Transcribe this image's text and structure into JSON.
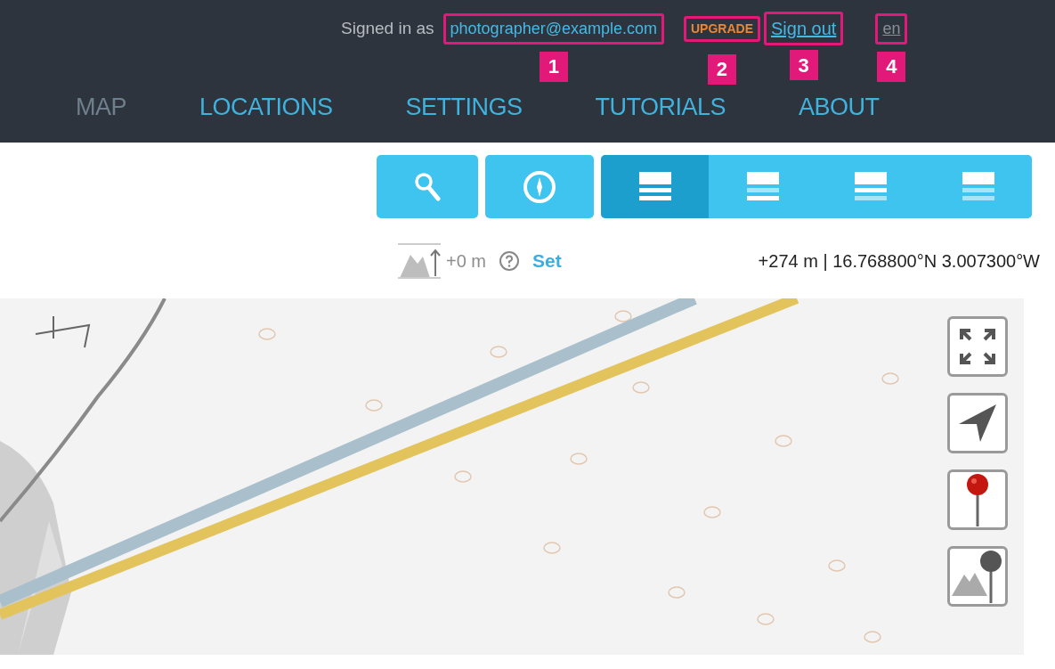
{
  "header": {
    "signed_in_label": "Signed in as",
    "links": [
      {
        "kind": "account",
        "text": "photographer@example.com",
        "callout": "1"
      },
      {
        "kind": "upgrade",
        "text": "UPGRADE",
        "callout": "2"
      },
      {
        "kind": "sign_out",
        "text": "Sign out",
        "callout": "3"
      },
      {
        "kind": "language",
        "text": "en",
        "callout": "4"
      }
    ]
  },
  "nav": [
    {
      "label": "MAP",
      "selected": true
    },
    {
      "label": "LOCATIONS",
      "selected": false
    },
    {
      "label": "SETTINGS",
      "selected": false
    },
    {
      "label": "TUTORIALS",
      "selected": false
    },
    {
      "label": "ABOUT",
      "selected": false
    }
  ],
  "toolbar": {
    "buttons": [
      {
        "kind": "search"
      },
      {
        "kind": "compass"
      }
    ],
    "layers": [
      {
        "kind": "all",
        "selected": true
      },
      {
        "kind": "base",
        "selected": false
      },
      {
        "kind": "mid",
        "selected": false
      },
      {
        "kind": "top",
        "selected": false
      }
    ]
  },
  "elevation": {
    "offset": "+0 m",
    "set_link": "Set"
  },
  "position": "+274 m | 16.768800°N 3.007300°W",
  "map": {
    "kind": "picture",
    "controls": [
      {
        "kind": "fullscreen"
      },
      {
        "kind": "locate"
      },
      {
        "kind": "pin"
      },
      {
        "kind": "elevation_pin"
      }
    ]
  }
}
